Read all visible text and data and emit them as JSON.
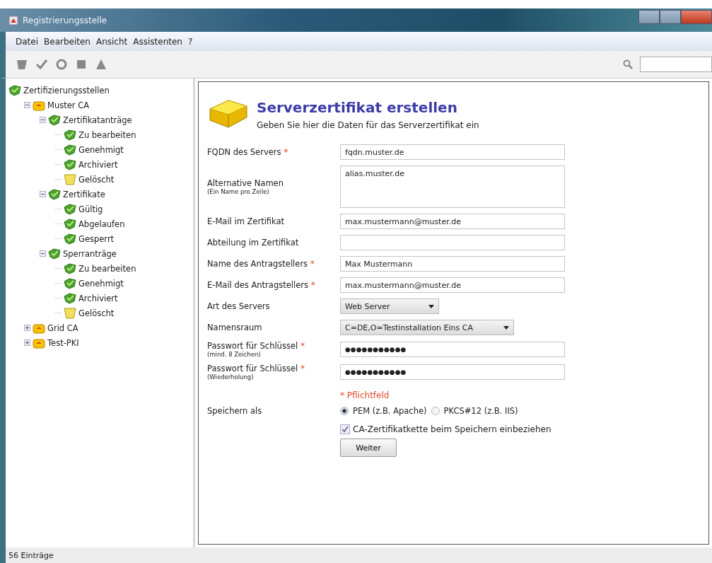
{
  "window": {
    "title": "Registrierungsstelle"
  },
  "menu": [
    "Datei",
    "Bearbeiten",
    "Ansicht",
    "Assistenten",
    "?"
  ],
  "tree": [
    {
      "label": "Zertifizierungsstellen",
      "kind": "cert",
      "children": [
        {
          "label": "Muster CA",
          "kind": "ca",
          "expanded": true,
          "children": [
            {
              "label": "Zertifikatanträge",
              "kind": "cert",
              "expanded": true,
              "children": [
                {
                  "label": "Zu bearbeiten",
                  "kind": "cert"
                },
                {
                  "label": "Genehmigt",
                  "kind": "cert"
                },
                {
                  "label": "Archiviert",
                  "kind": "cert"
                },
                {
                  "label": "Gelöscht",
                  "kind": "deleted"
                }
              ]
            },
            {
              "label": "Zertifikate",
              "kind": "cert",
              "expanded": true,
              "children": [
                {
                  "label": "Gültig",
                  "kind": "cert"
                },
                {
                  "label": "Abgelaufen",
                  "kind": "cert"
                },
                {
                  "label": "Gesperrt",
                  "kind": "cert"
                }
              ]
            },
            {
              "label": "Sperranträge",
              "kind": "cert",
              "expanded": true,
              "children": [
                {
                  "label": "Zu bearbeiten",
                  "kind": "cert"
                },
                {
                  "label": "Genehmigt",
                  "kind": "cert"
                },
                {
                  "label": "Archiviert",
                  "kind": "cert"
                },
                {
                  "label": "Gelöscht",
                  "kind": "deleted"
                }
              ]
            }
          ]
        },
        {
          "label": "Grid CA",
          "kind": "ca",
          "expanded": false
        },
        {
          "label": "Test-PKI",
          "kind": "ca",
          "expanded": false
        }
      ]
    }
  ],
  "form": {
    "title": "Serverzertifikat erstellen",
    "subtitle": "Geben Sie hier die Daten für das Serverzertifikat ein",
    "fields": [
      {
        "kind": "text",
        "label": "FQDN des Servers",
        "required_mark": "*",
        "value": "fqdn.muster.de"
      },
      {
        "kind": "textarea",
        "label": "Alternative Namen",
        "sublabel": "(Ein Name pro Zeile)",
        "value": "alias.muster.de"
      },
      {
        "kind": "text",
        "label": "E-Mail im Zertifikat",
        "value": "max.mustermann@muster.de"
      },
      {
        "kind": "text",
        "label": "Abteilung im Zertifikat"
      },
      {
        "kind": "text",
        "label": "Name des Antragstellers",
        "required_mark": "*",
        "value": "Max Mustermann"
      },
      {
        "kind": "text",
        "label": "E-Mail des Antragstellers",
        "required_mark": "*",
        "value": "max.mustermann@muster.de"
      },
      {
        "kind": "select",
        "label": "Art des Servers",
        "value": "Web Server"
      },
      {
        "kind": "select-wide",
        "label": "Namensraum",
        "value": "C=DE,O=Testinstallation Eins CA"
      },
      {
        "kind": "password",
        "label": "Passwort für Schlüssel",
        "sublabel": "(mind. 8 Zeichen)",
        "required_mark": "*",
        "value": "●●●●●●●●●●●"
      },
      {
        "kind": "password",
        "label": "Passwort für Schlüssel",
        "sublabel": "(Wiederholung)",
        "required_mark": "*",
        "value": "●●●●●●●●●●●"
      }
    ],
    "required_note": "* Pflichtfeld",
    "save_as": {
      "label": "Speichern als",
      "options": [
        {
          "label": "PEM (z.B. Apache)",
          "selected": true
        },
        {
          "label": "PKCS#12 (z.B. IIS)",
          "selected": false
        }
      ]
    },
    "checkbox": {
      "label": "CA-Zertifikatkette beim Speichern einbeziehen",
      "checked": true
    },
    "button": "Weiter"
  },
  "status_bar": "56 Einträge"
}
